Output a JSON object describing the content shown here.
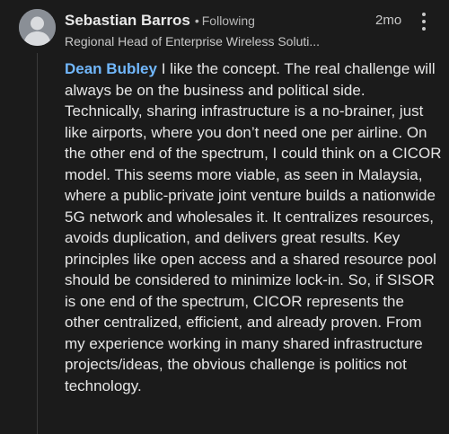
{
  "author": {
    "name": "Sebastian Barros",
    "separator": "•",
    "follow_status": "Following",
    "headline": "Regional Head of Enterprise Wireless Soluti...",
    "avatar_icon": "default-person-avatar"
  },
  "timestamp": "2mo",
  "more_icon": "vertical-ellipsis-icon",
  "comment": {
    "mention": "Dean Bubley",
    "text": "I like the concept. The real challenge will always be on the business and political side. Technically, sharing infrastructure is a no-brainer, just like airports, where you don’t need one per airline. On the other end of the spectrum, I could think on a CICOR model. This seems more viable, as seen in Malaysia, where a public-private joint venture builds a nationwide 5G network and wholesales it. It centralizes resources, avoids duplication, and delivers great results. Key principles like open access and a shared resource pool should be considered to minimize lock-in. So, if SISOR is one end of the spectrum, CICOR represents the other centralized, efficient, and already proven. From my experience working in many shared infrastructure projects/ideas, the obvious challenge is politics not technology."
  },
  "colors": {
    "background": "#1b1b1b",
    "mention": "#71b7fb",
    "text": "#e6e6e6",
    "muted": "#b8b8b8"
  }
}
